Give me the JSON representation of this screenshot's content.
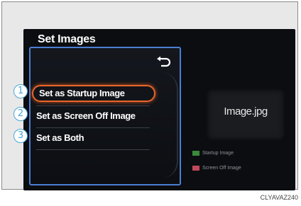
{
  "screen": {
    "title": "Set Images",
    "menu": {
      "items": [
        {
          "label": "Set as Startup Image",
          "selected": true
        },
        {
          "label": "Set as Screen Off Image",
          "selected": false
        },
        {
          "label": "Set as Both",
          "selected": false
        }
      ]
    },
    "preview": {
      "filename": "Image.jpg"
    },
    "legend": [
      {
        "label": "Startup Image",
        "color": "#3a8a3a"
      },
      {
        "label": "Screen Off Image",
        "color": "#c0485a"
      }
    ]
  },
  "callouts": [
    "1",
    "2",
    "3"
  ],
  "caption": "CLYAVAZ240",
  "colors": {
    "frame_border": "#4c7fd4",
    "selection_ring": "#e8652a",
    "callout": "#4aa6d6"
  }
}
